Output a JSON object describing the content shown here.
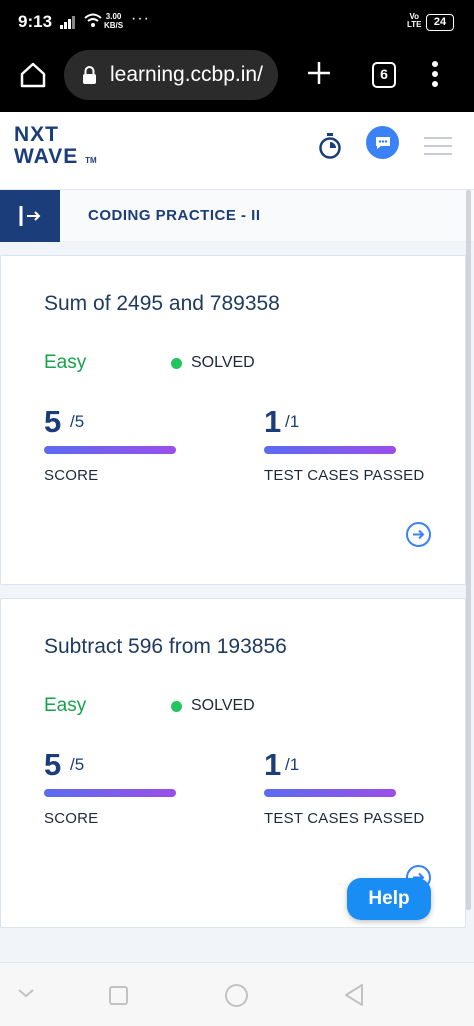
{
  "status_bar": {
    "time": "9:13",
    "speed_value": "3.00",
    "speed_unit": "KB/S",
    "more": "···",
    "volte_top": "Vo",
    "volte_bottom": "LTE",
    "battery": "24"
  },
  "browser": {
    "url": "learning.ccbp.in/",
    "tab_count": "6"
  },
  "header": {
    "logo_line1": "NXT",
    "logo_line2": "WAVE",
    "logo_tm": "TM"
  },
  "section": {
    "title": "CODING PRACTICE - II"
  },
  "problems": [
    {
      "title": "Sum of 2495 and 789358",
      "difficulty": "Easy",
      "status": "SOLVED",
      "score": "5",
      "score_total": "/5",
      "score_label": "SCORE",
      "tests": "1",
      "tests_total": "/1",
      "tests_label": "TEST CASES PASSED"
    },
    {
      "title": "Subtract 596 from 193856",
      "difficulty": "Easy",
      "status": "SOLVED",
      "score": "5",
      "score_total": "/5",
      "score_label": "SCORE",
      "tests": "1",
      "tests_total": "/1",
      "tests_label": "TEST CASES PASSED"
    }
  ],
  "help_button": "Help",
  "colors": {
    "brand": "#1b3e7a",
    "easy": "#16a34a",
    "solved_dot": "#22c55e",
    "help": "#1a8df5"
  },
  "icons": [
    "home-icon",
    "lock-icon",
    "plus-icon",
    "tabs-icon",
    "menu-icon",
    "stopwatch-icon",
    "chat-icon",
    "hamburger-icon",
    "collapse-sidebar-icon",
    "arrow-right-circle-icon",
    "nav-back-icon",
    "nav-home-icon",
    "nav-recents-icon"
  ]
}
